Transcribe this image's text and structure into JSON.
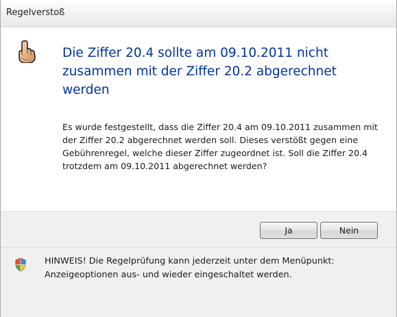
{
  "window": {
    "title": "Regelverstoß"
  },
  "icons": {
    "warning": "pointing-hand-icon",
    "footer": "shield-icon"
  },
  "main": {
    "heading": "Die Ziffer 20.4 sollte am 09.10.2011 nicht zusammen mit der Ziffer 20.2 abgerechnet werden",
    "message": "Es wurde festgestellt, dass die Ziffer 20.4 am 09.10.2011 zusammen mit der Ziffer 20.2 abgerechnet werden soll. Dieses verstößt gegen eine Gebührenregel, welche dieser Ziffer zugeordnet ist. Soll die Ziffer 20.4 trotzdem am 09.10.2011 abgerechnet werden?"
  },
  "buttons": {
    "yes_label": "Ja",
    "no_label": "Nein"
  },
  "footer": {
    "note": "HINWEIS! Die Regelprüfung kann jederzeit unter dem Menüpunkt: Anzeigeoptionen aus- und wieder eingeschaltet werden."
  },
  "colors": {
    "heading": "#003399",
    "button_bar": "#f0f0f0",
    "footer": "#f0f0f0"
  }
}
